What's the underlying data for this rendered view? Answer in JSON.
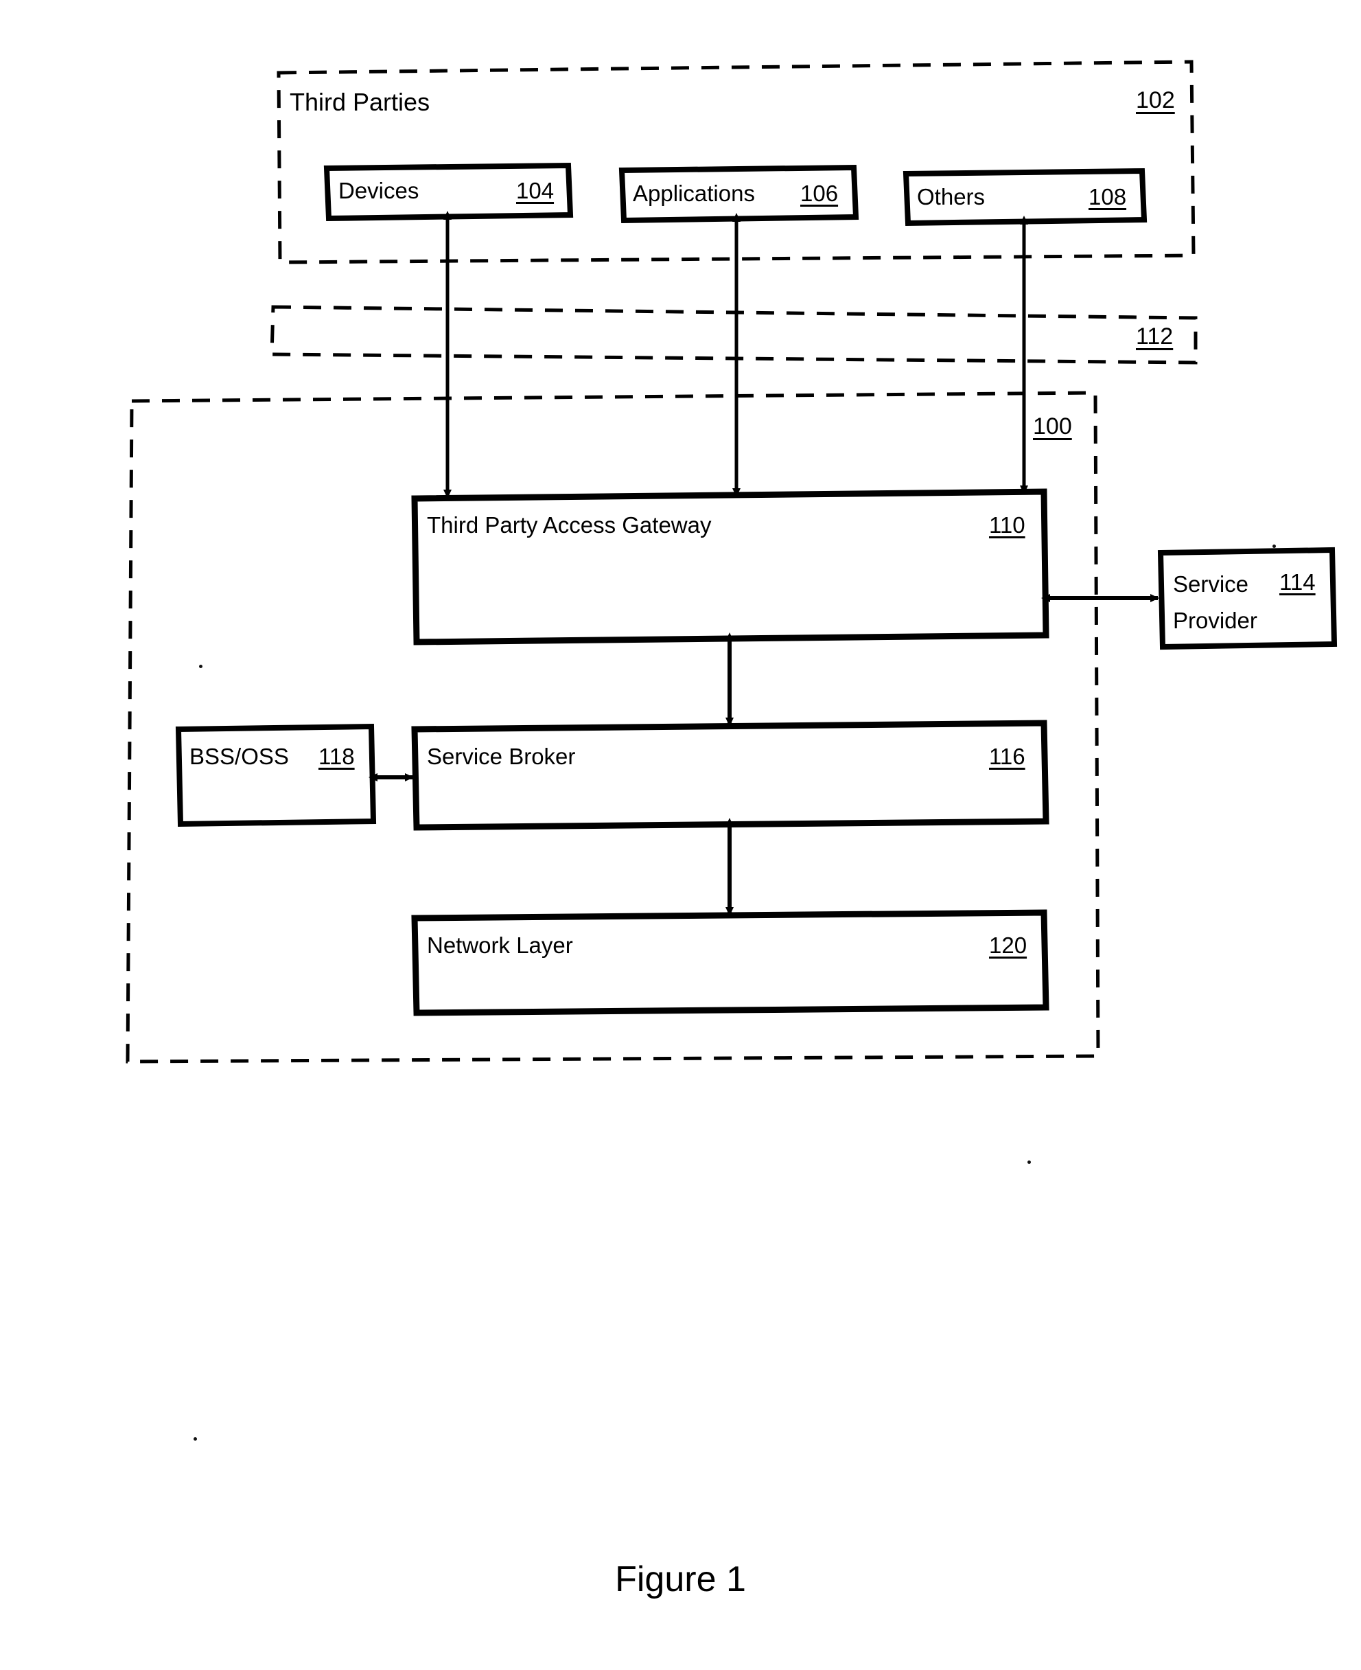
{
  "figure": {
    "caption": "Figure 1",
    "type": "patent-block-diagram"
  },
  "groups": {
    "third_parties": {
      "label": "Third Parties",
      "ref": "102",
      "style": "dashed-container"
    },
    "interface_band": {
      "label": "",
      "ref": "112",
      "style": "dashed-band"
    },
    "system": {
      "label": "",
      "ref": "100",
      "style": "dashed-container"
    }
  },
  "boxes": [
    {
      "id": "devices",
      "label": "Devices",
      "ref": "104"
    },
    {
      "id": "applications",
      "label": "Applications",
      "ref": "106"
    },
    {
      "id": "others",
      "label": "Others",
      "ref": "108"
    },
    {
      "id": "gateway",
      "label": "Third Party Access Gateway",
      "ref": "110"
    },
    {
      "id": "service_provider",
      "label": "Service Provider",
      "label_line1": "Service",
      "label_line2": "Provider",
      "ref": "114"
    },
    {
      "id": "bss_oss",
      "label": "BSS/OSS",
      "ref": "118"
    },
    {
      "id": "service_broker",
      "label": "Service Broker",
      "ref": "116"
    },
    {
      "id": "network_layer",
      "label": "Network Layer",
      "ref": "120"
    }
  ],
  "connections": [
    {
      "from": "devices",
      "to": "gateway",
      "arrow": "double",
      "orientation": "vertical"
    },
    {
      "from": "applications",
      "to": "gateway",
      "arrow": "double",
      "orientation": "vertical"
    },
    {
      "from": "others",
      "to": "gateway",
      "arrow": "double",
      "orientation": "vertical"
    },
    {
      "from": "gateway",
      "to": "service_provider",
      "arrow": "double",
      "orientation": "horizontal"
    },
    {
      "from": "gateway",
      "to": "service_broker",
      "arrow": "double",
      "orientation": "vertical"
    },
    {
      "from": "bss_oss",
      "to": "service_broker",
      "arrow": "double",
      "orientation": "horizontal"
    },
    {
      "from": "service_broker",
      "to": "network_layer",
      "arrow": "double",
      "orientation": "vertical"
    }
  ],
  "colors": {
    "ink": "#000000",
    "paper": "#ffffff"
  }
}
